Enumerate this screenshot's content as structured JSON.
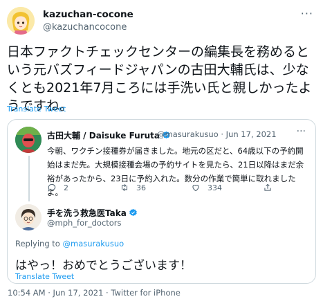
{
  "tweet": {
    "author_name": "kazuchan-cocone",
    "author_handle": "@kazuchancocone",
    "more_icon": "more-horizontal-icon",
    "text": "日本ファクトチェックセンターの編集長を務めるという元バズフィードジャパンの古田大輔氏は、少なくとも2021年7月ころには手洗い氏と親しかったようですね。",
    "translate_label": "Translate Tweet"
  },
  "quoted_tweet": {
    "author_name": "古田大輔 / Daisuke Furuta",
    "meta": "@masurakusuo · Jun 17, 2021",
    "text": "今朝、ワクチン接種券が届きました。地元の区だと、64歳以下の予約開始はまだ先。大規模接種会場の予約サイトを見たら、21日以降はまだ余裕があったから、23日に予約入れた。数分の作業で簡単に取れましたよ。",
    "reply_count": "2",
    "retweet_count": "36",
    "like_count": "334"
  },
  "reply": {
    "author_name": "手を洗う救急医Taka",
    "author_handle": "@mph_for_doctors",
    "replying_to_prefix": "Replying to",
    "replying_to_handle": "@masurakusuo",
    "text": "はやっ！おめでとうございます！",
    "translate_label": "Translate Tweet"
  },
  "footer": {
    "timestamp": "10:54 AM · Jun 17, 2021 · Twitter for iPhone"
  },
  "colors": {
    "link": "#1d9bf0",
    "secondary_text": "#536471",
    "border": "#cfd9de"
  }
}
